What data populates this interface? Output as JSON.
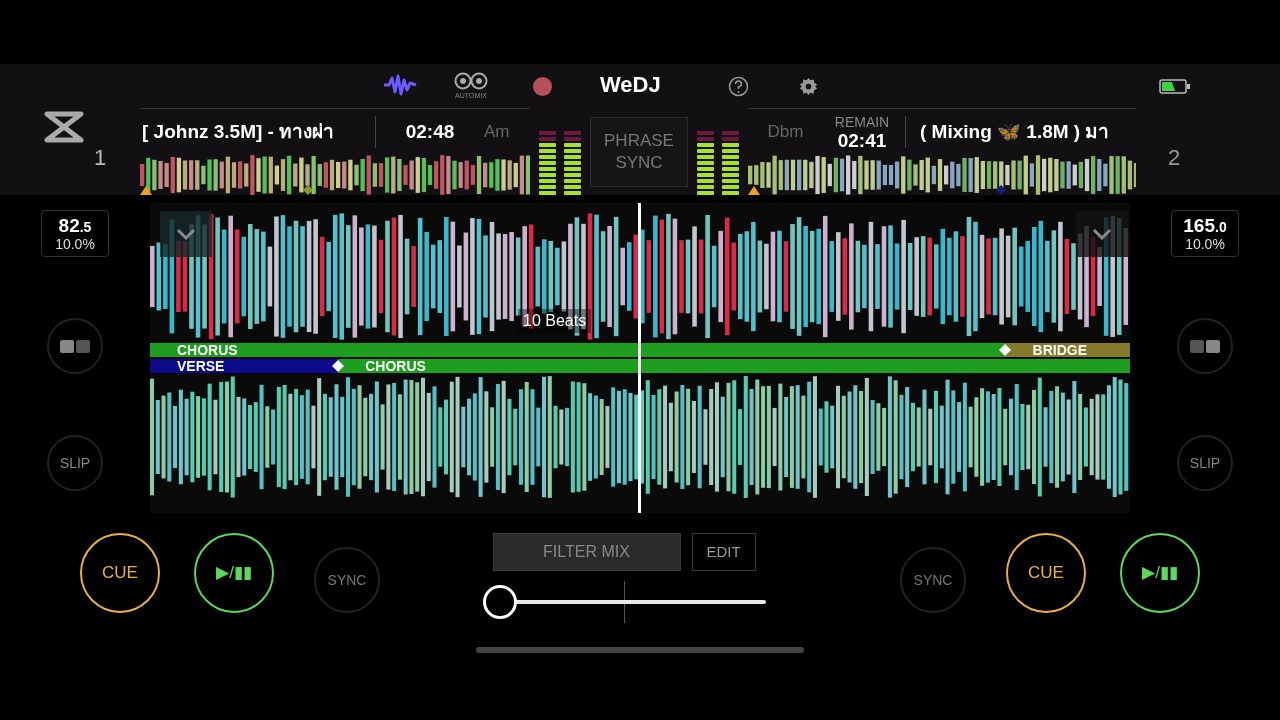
{
  "header": {
    "automix_label": "AUTOMIX",
    "logo": "WeDJ"
  },
  "decks": [
    {
      "number": "1",
      "title": "[ Johnz 3.5M] - ทางผ่า",
      "time": "02:48",
      "key": "Am",
      "bpm": "82",
      "bpm_fraction": ".5",
      "pitch": "10.0%",
      "meters": [
        {
          "level": 0.8
        },
        {
          "level": 0.8
        }
      ],
      "slip": "SLIP",
      "cue": "CUE",
      "play": "▶/▮▮",
      "sync": "SYNC",
      "phrases": [
        {
          "label": "CHORUS",
          "color": "#1e9e1e"
        },
        {
          "label": "BRIDGE",
          "color": "#857a2a"
        }
      ]
    },
    {
      "number": "2",
      "time_label": "REMAIN",
      "title": "( Mixing 🦋 1.8M ) มา",
      "time": "02:41",
      "key": "Dbm",
      "bpm": "165",
      "bpm_fraction": ".0",
      "pitch": "10.0%",
      "meters": [
        {
          "level": 0.8
        },
        {
          "level": 0.8
        }
      ],
      "slip": "SLIP",
      "cue": "CUE",
      "play": "▶/▮▮",
      "sync": "SYNC",
      "phrases": [
        {
          "label": "VERSE",
          "color": "#0b0b8c"
        },
        {
          "label": "CHORUS",
          "color": "#1e9e1e"
        }
      ]
    }
  ],
  "phrase_sync": "PHRASE SYNC",
  "beat_label": "10 Beats",
  "mixer": {
    "filter_mix": "FILTER MIX",
    "edit": "EDIT",
    "crossfader": {
      "level": 0.05
    }
  }
}
